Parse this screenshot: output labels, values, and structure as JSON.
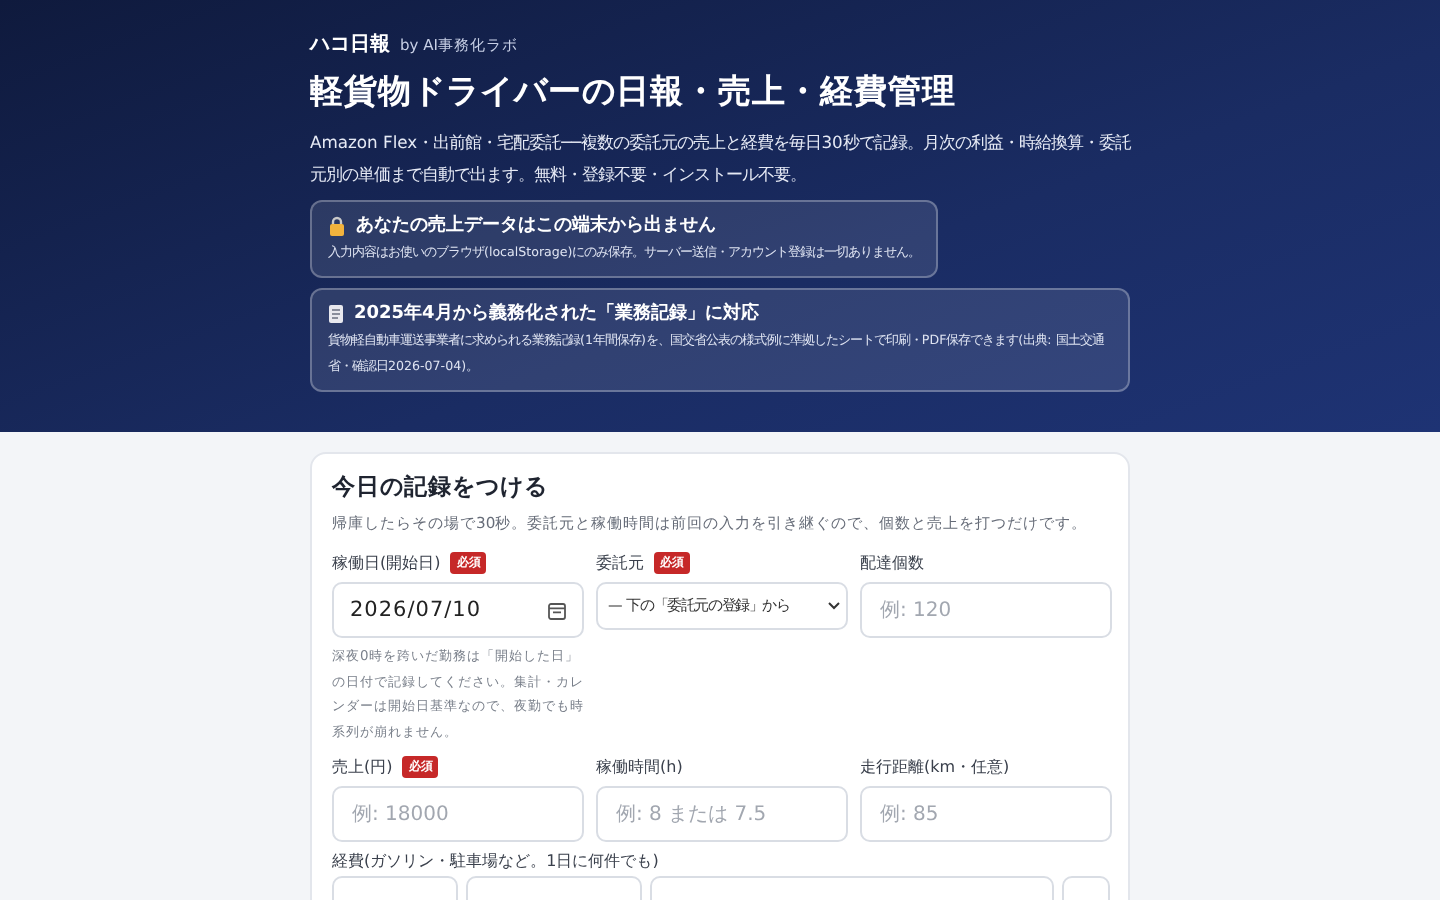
{
  "header": {
    "brand": "ハコ日報",
    "byline": "by AI事務化ラボ",
    "title": "軽貨物ドライバーの日報・売上・経費管理",
    "description": "Amazon Flex・出前館・宅配委託──複数の委託元の売上と経費を毎日30秒で記録。月次の利益・時給換算・委託元別の単価まで自動で出ます。無料・登録不要・インストール不要。"
  },
  "notices": [
    {
      "kind": "lock",
      "title": "あなたの売上データはこの端末から出ません",
      "body": "入力内容はお使いのブラウザ(localStorage)にのみ保存。サーバー送信・アカウント登録は一切ありません。"
    },
    {
      "kind": "document",
      "title": "2025年4月から義務化された「業務記録」に対応",
      "body": "貨物軽自動車運送事業者に求められる業務記録(1年間保存)を、国交省公表の様式例に準拠したシートで印刷・PDF保存できます(出典: 国土交通省・確認日2026-07-04)。"
    }
  ],
  "form": {
    "title": "今日の記録をつける",
    "subtitle": "帰庫したらその場で30秒。委託元と稼働時間は前回の入力を引き継ぐので、個数と売上を打つだけです。",
    "fields": [
      {
        "kind": "date",
        "label": "稼働日(開始日)",
        "badge": "必須",
        "value": "2026/07/10",
        "hint": "深夜0時を跨いだ勤務は「開始した日」の日付で記録してください。集計・カレンダーは開始日基準なので、夜勤でも時系列が崩れません。"
      },
      {
        "kind": "select",
        "label": "委託元",
        "badge": "必須",
        "value": "— 下の「委託元の登録」から"
      },
      {
        "kind": "text",
        "label": "配達個数",
        "placeholder": "例: 120"
      },
      {
        "kind": "text",
        "label": "売上(円)",
        "badge": "必須",
        "placeholder": "例: 18000"
      },
      {
        "kind": "text",
        "label": "稼働時間(h)",
        "placeholder": "例: 8 または 7.5"
      },
      {
        "kind": "text",
        "label": "走行距離(km・任意)",
        "placeholder": "例: 85"
      }
    ],
    "expenses_label": "経費(ガソリン・駐車場など。1日に何件でも)"
  }
}
